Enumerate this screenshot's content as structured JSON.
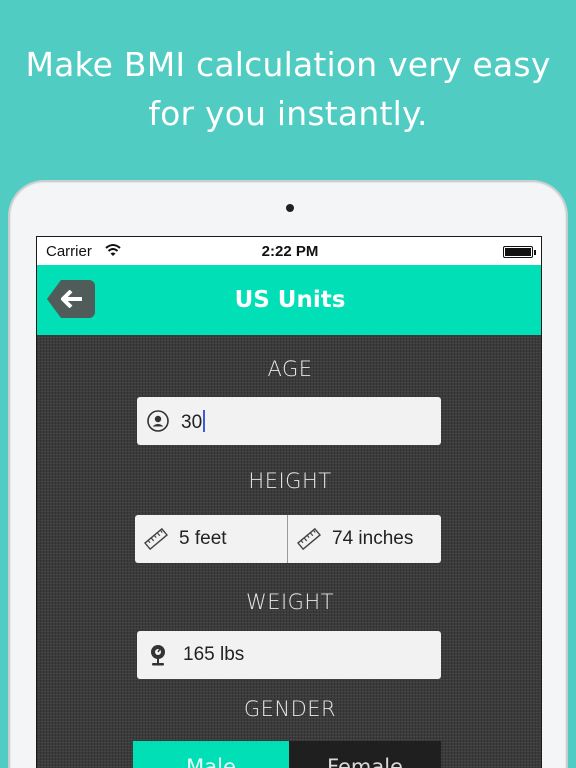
{
  "promo": {
    "line1": "Make BMI calculation very easy",
    "line2": "for you instantly."
  },
  "status_bar": {
    "carrier": "Carrier",
    "time": "2:22 PM",
    "wifi_icon": "wifi-icon",
    "battery_icon": "battery-icon"
  },
  "navbar": {
    "title": "US Units",
    "back_icon": "arrow-left-icon"
  },
  "form": {
    "age": {
      "label": "AGE",
      "value": "30",
      "icon": "person-icon"
    },
    "height": {
      "label": "HEIGHT",
      "feet_value": "5 feet",
      "inches_value": "74 inches",
      "icon": "ruler-icon"
    },
    "weight": {
      "label": "WEIGHT",
      "value": "165 lbs",
      "icon": "scale-icon"
    },
    "gender": {
      "label": "GENDER",
      "options": [
        "Male",
        "Female"
      ],
      "selected": "Male"
    }
  },
  "colors": {
    "background": "#50ccc2",
    "accent": "#00dfb5",
    "back_button": "#4f5c5a",
    "content_bg": "#3b3b3b"
  }
}
